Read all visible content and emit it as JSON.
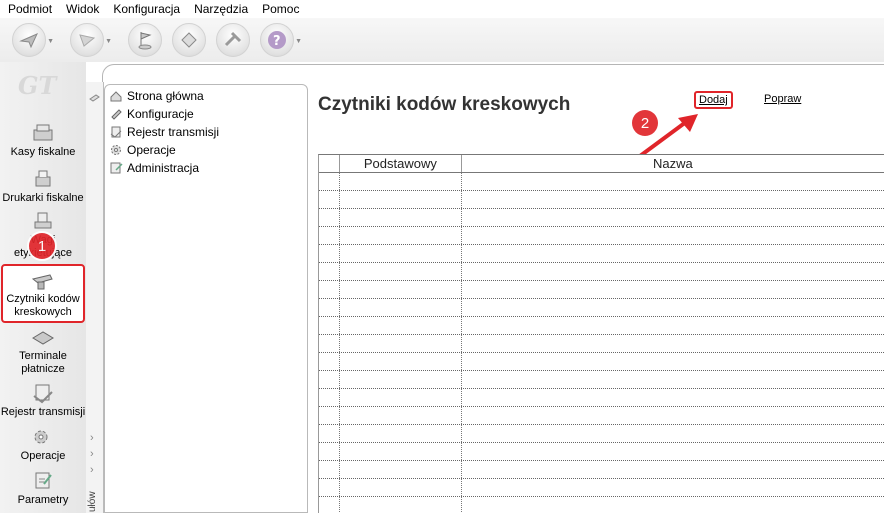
{
  "menu": [
    "Podmiot",
    "Widok",
    "Konfiguracja",
    "Narzędzia",
    "Pomoc"
  ],
  "toolbar": {
    "buttons": [
      {
        "icon": "send-icon",
        "dropdown": true
      },
      {
        "icon": "receive-icon",
        "dropdown": true
      },
      {
        "icon": "flag-icon",
        "dropdown": false
      },
      {
        "icon": "tag-icon",
        "dropdown": false
      },
      {
        "icon": "tools-icon",
        "dropdown": false
      },
      {
        "icon": "help-icon",
        "dropdown": true
      }
    ]
  },
  "logo": "GT",
  "modules": [
    {
      "label": "Kasy fiskalne",
      "icon": "cash-register-icon"
    },
    {
      "label": "Drukarki fiskalne",
      "icon": "fiscal-printer-icon"
    },
    {
      "label": "Wagi etykietujące",
      "icon": "label-scale-icon"
    },
    {
      "label": "Czytniki kodów kreskowych",
      "icon": "barcode-scanner-icon",
      "selected": true
    },
    {
      "label": "Terminale płatnicze",
      "icon": "payment-terminal-icon"
    },
    {
      "label": "Rejestr transmisji",
      "icon": "transmission-log-icon"
    },
    {
      "label": "Operacje",
      "icon": "gears-icon"
    },
    {
      "label": "Parametry",
      "icon": "parameters-icon"
    }
  ],
  "splitter_text": "ułów",
  "nav": [
    {
      "label": "Strona główna",
      "icon": "home-icon"
    },
    {
      "label": "Konfiguracje",
      "icon": "config-icon"
    },
    {
      "label": "Rejestr transmisji",
      "icon": "transmission-icon"
    },
    {
      "label": "Operacje",
      "icon": "operations-icon"
    },
    {
      "label": "Administracja",
      "icon": "admin-icon"
    }
  ],
  "page": {
    "title": "Czytniki kodów kreskowych",
    "add_link": "Dodaj",
    "edit_link": "Popraw"
  },
  "annotations": {
    "badge1": "1",
    "badge2": "2"
  },
  "grid": {
    "columns": [
      "",
      "Podstawowy",
      "Nazwa"
    ],
    "rows": [
      [],
      [],
      [],
      [],
      [],
      [],
      [],
      [],
      [],
      [],
      [],
      [],
      [],
      [],
      [],
      [],
      [],
      [],
      []
    ]
  },
  "colors": {
    "highlight": "#e0252a",
    "title": "#333333"
  }
}
